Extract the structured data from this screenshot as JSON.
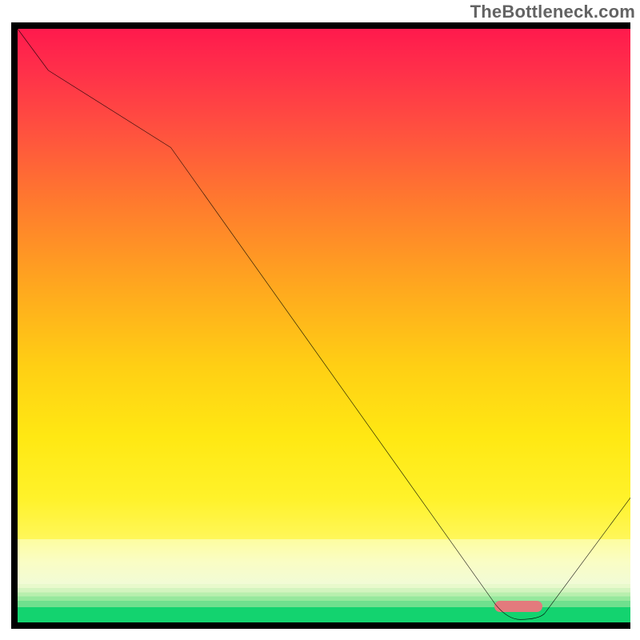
{
  "attribution": "TheBottleneck.com",
  "chart_data": {
    "type": "line",
    "series": [
      {
        "name": "curve",
        "x": [
          0,
          5,
          25,
          78,
          82,
          86,
          100
        ],
        "y": [
          100,
          93,
          80,
          3,
          0,
          1,
          21
        ]
      }
    ],
    "xlabel": "",
    "ylabel": "",
    "xlim": [
      0,
      100
    ],
    "ylim": [
      0,
      100
    ],
    "background_gradient": [
      "#ff1a4d",
      "#ff7a2e",
      "#ffe813",
      "#fdfda0",
      "#13d36f"
    ],
    "marker": {
      "x_start": 78,
      "x_end": 86,
      "color": "#e37a7d"
    },
    "title": ""
  }
}
